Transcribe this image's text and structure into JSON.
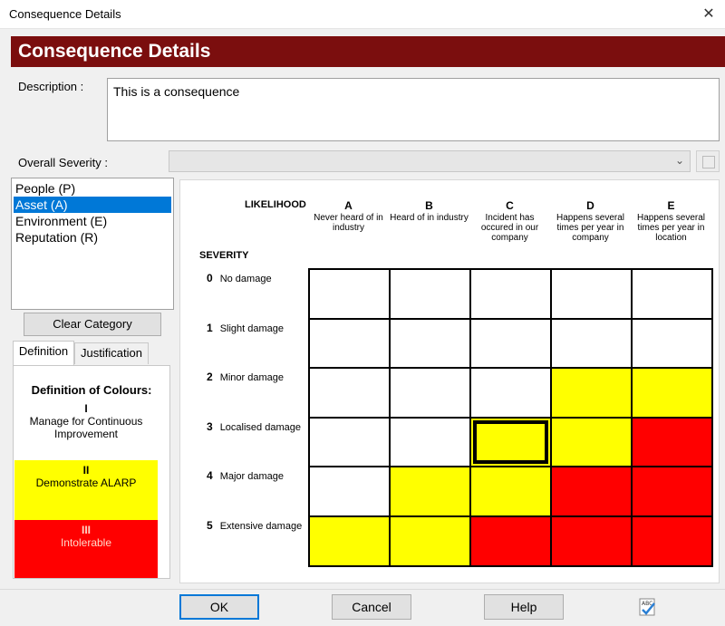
{
  "window": {
    "title": "Consequence Details",
    "close_glyph": "✕"
  },
  "header": {
    "title": "Consequence Details"
  },
  "description": {
    "label": "Description :",
    "value": "This is a consequence"
  },
  "overall_severity": {
    "label": "Overall Severity :",
    "value": ""
  },
  "categories": [
    {
      "label": "People (P)",
      "selected": false
    },
    {
      "label": "Asset (A)",
      "selected": true
    },
    {
      "label": "Environment (E)",
      "selected": false
    },
    {
      "label": "Reputation (R)",
      "selected": false
    }
  ],
  "clear_category_label": "Clear Category",
  "tabs": [
    {
      "label": "Definition",
      "active": true
    },
    {
      "label": "Justification",
      "active": false
    }
  ],
  "definition": {
    "title": "Definition of Colours:",
    "bands": [
      {
        "num": "I",
        "text": "Manage for Continuous Improvement",
        "color": "#ffffff"
      },
      {
        "num": "II",
        "text": "Demonstrate ALARP",
        "color": "#ffff00"
      },
      {
        "num": "III",
        "text": "Intolerable",
        "color": "#ff0000"
      }
    ]
  },
  "matrix": {
    "likelihood_label": "LIKELIHOOD",
    "severity_label": "SEVERITY",
    "columns": [
      {
        "letter": "A",
        "desc": "Never heard of in industry"
      },
      {
        "letter": "B",
        "desc": "Heard of in industry"
      },
      {
        "letter": "C",
        "desc": "Incident has occured in our company"
      },
      {
        "letter": "D",
        "desc": "Happens several times per year in company"
      },
      {
        "letter": "E",
        "desc": "Happens several times per year in location"
      }
    ],
    "rows": [
      {
        "num": "0",
        "label": "No damage"
      },
      {
        "num": "1",
        "label": "Slight damage"
      },
      {
        "num": "2",
        "label": "Minor damage"
      },
      {
        "num": "3",
        "label": "Localised damage"
      },
      {
        "num": "4",
        "label": "Major damage"
      },
      {
        "num": "5",
        "label": "Extensive damage"
      }
    ],
    "cells": [
      [
        "white",
        "white",
        "white",
        "white",
        "white"
      ],
      [
        "white",
        "white",
        "white",
        "white",
        "white"
      ],
      [
        "white",
        "white",
        "white",
        "yellow",
        "yellow"
      ],
      [
        "white",
        "white",
        "yellow",
        "yellow",
        "red"
      ],
      [
        "white",
        "yellow",
        "yellow",
        "red",
        "red"
      ],
      [
        "yellow",
        "yellow",
        "red",
        "red",
        "red"
      ]
    ],
    "selected_cell": {
      "row": 3,
      "col": 2
    },
    "colors": {
      "white": "#ffffff",
      "yellow": "#ffff00",
      "red": "#ff0000"
    }
  },
  "buttons": {
    "ok": "OK",
    "cancel": "Cancel",
    "help": "Help",
    "spellcheck_icon": "spellcheck-icon"
  }
}
